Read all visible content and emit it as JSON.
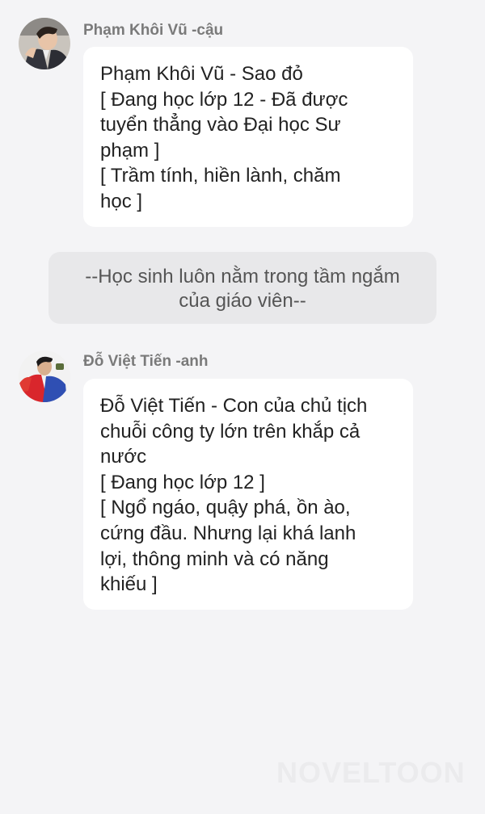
{
  "messages": [
    {
      "sender": "Phạm Khôi Vũ -cậu",
      "avatar_icon": "avatar-boy-suit-icon",
      "lines": [
        "Phạm Khôi Vũ - Sao đỏ",
        "[ Đang học lớp 12 - Đã được",
        "tuyển thẳng vào Đại học Sư",
        "phạm ]",
        "[ Trầm tính, hiền lành, chăm",
        "học ]"
      ]
    },
    {
      "sender": "Đỗ Việt Tiến -anh",
      "avatar_icon": "avatar-boy-red-jacket-icon",
      "lines": [
        "Đỗ Việt Tiến - Con của chủ tịch",
        "chuỗi công ty lớn trên khắp cả",
        "nước",
        "[ Đang học lớp 12 ]",
        "[ Ngổ ngáo, quậy phá, ồn ào,",
        "cứng đầu. Nhưng lại khá lanh",
        "lợi, thông minh và có năng",
        "khiếu ]"
      ]
    }
  ],
  "narration": {
    "lines": [
      "--Học sinh luôn nằm trong tầm ngắm",
      "của giáo viên--"
    ]
  },
  "watermark": "NOVELTOON",
  "colors": {
    "background": "#f4f4f6",
    "bubble": "#ffffff",
    "narration_bg": "#e8e8ea",
    "sender_name": "#7a7a7a",
    "text": "#222222"
  }
}
